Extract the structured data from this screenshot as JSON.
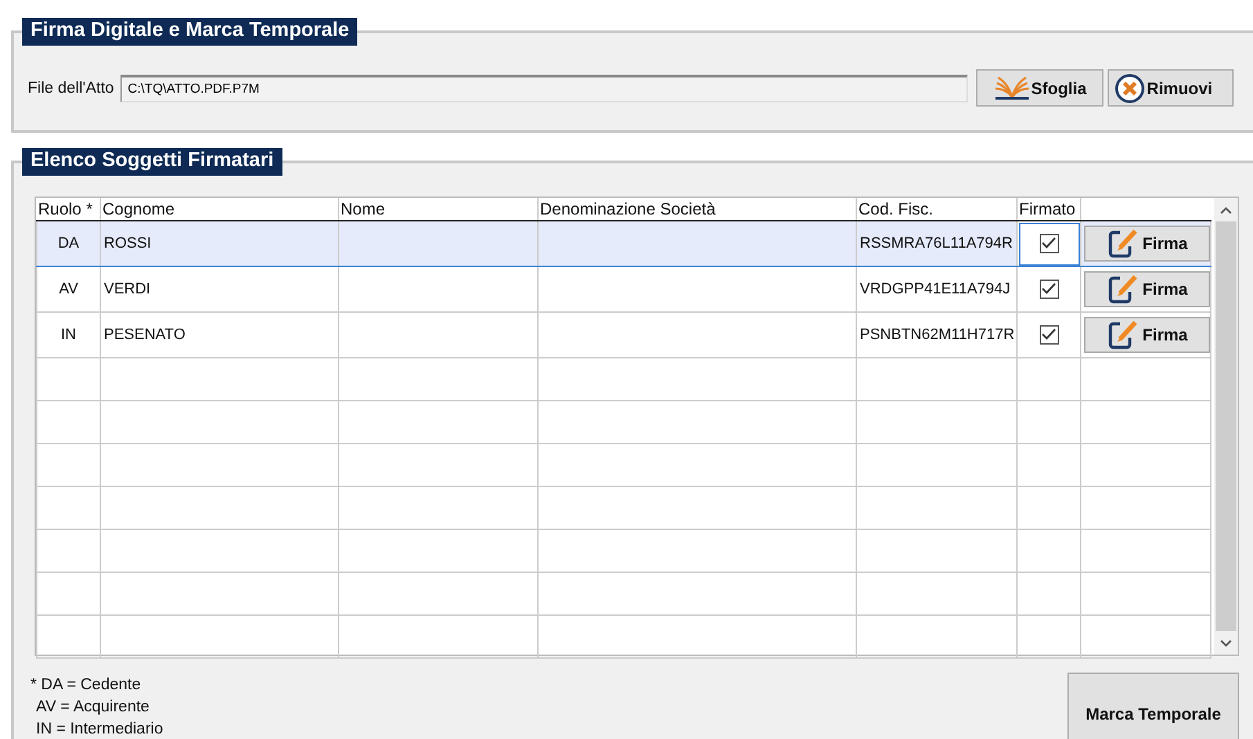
{
  "file_panel": {
    "title": "Firma Digitale e Marca Temporale",
    "file_label": "File dell'Atto",
    "file_value": "C:\\TQ\\ATTO.PDF.P7M",
    "buttons": [
      {
        "kind": "browse",
        "label": "Sfoglia"
      },
      {
        "kind": "remove",
        "label": "Rimuovi"
      }
    ]
  },
  "signers_panel": {
    "title": "Elenco Soggetti Firmatari",
    "table": {
      "columns": [
        "Ruolo *",
        "Cognome",
        "Nome",
        "Denominazione Società",
        "Cod. Fisc.",
        "Firmato"
      ],
      "rows": [
        {
          "ruolo": "DA",
          "cognome": "ROSSI",
          "cod_fisc": "RSSMRA76L11A794R",
          "firmato": true,
          "selected": true,
          "action": "Firma"
        },
        {
          "ruolo": "AV",
          "cognome": "VERDI",
          "cod_fisc": "VRDGPP41E11A794J",
          "firmato": true,
          "selected": false,
          "action": "Firma"
        },
        {
          "ruolo": "IN",
          "cognome": "PESENATO",
          "cod_fisc": "PSNBTN62M11H717R",
          "firmato": true,
          "selected": false,
          "action": "Firma"
        }
      ]
    },
    "legend": [
      "* DA = Cedente",
      "AV = Acquirente",
      "IN = Intermediario"
    ],
    "timestamp_button": "Marca Temporale"
  }
}
